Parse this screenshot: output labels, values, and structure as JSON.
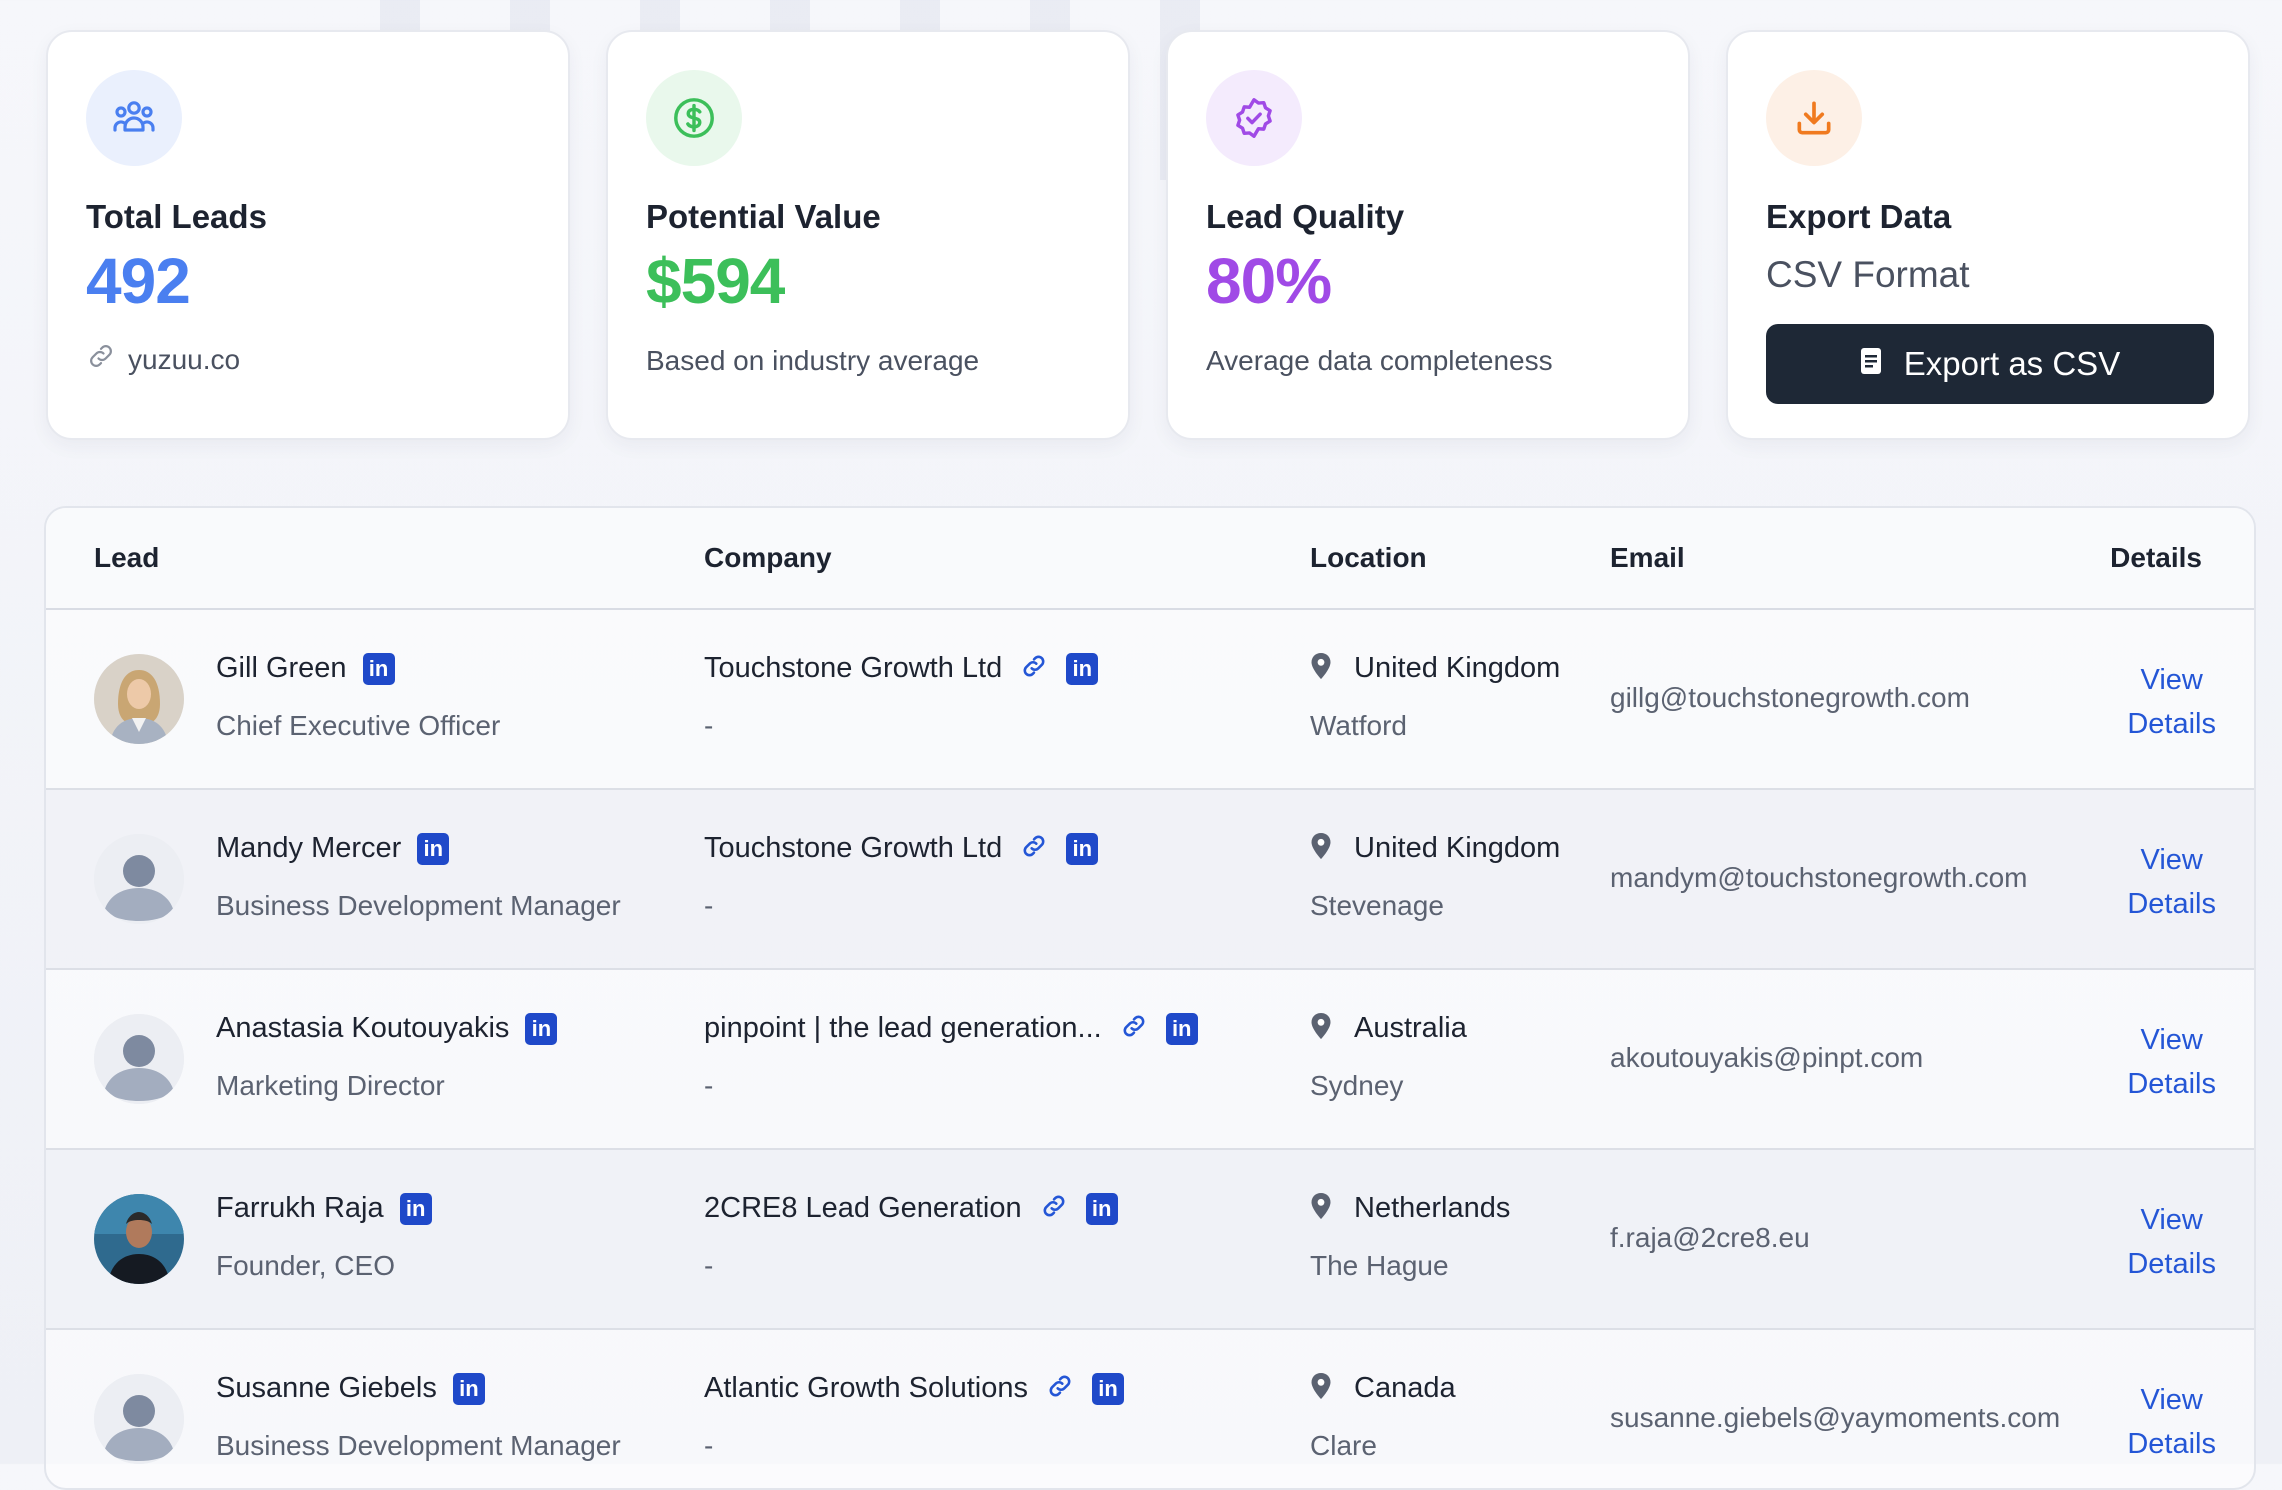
{
  "colors": {
    "blue": "#4a7ff0",
    "green": "#3cbf5a",
    "purple": "#a04ae6",
    "orange": "#f07a1f",
    "dark_button": "#1e2836",
    "link": "#2456d6",
    "linkedin": "#1f49c9"
  },
  "stats": {
    "total_leads": {
      "title": "Total Leads",
      "value": "492",
      "sub": "yuzuu.co",
      "icon": "users-group-icon"
    },
    "potential_value": {
      "title": "Potential Value",
      "value": "$594",
      "sub": "Based on industry average",
      "icon": "dollar-circle-icon"
    },
    "lead_quality": {
      "title": "Lead Quality",
      "value": "80%",
      "sub": "Average data completeness",
      "icon": "verified-badge-icon"
    },
    "export": {
      "title": "Export Data",
      "format": "CSV Format",
      "button": "Export as CSV",
      "icon": "download-icon"
    }
  },
  "table": {
    "headers": {
      "lead": "Lead",
      "company": "Company",
      "location": "Location",
      "email": "Email",
      "details": "Details"
    },
    "rows": [
      {
        "name": "Gill Green",
        "title": "Chief Executive Officer",
        "company": "Touchstone Growth Ltd",
        "company_sub": "-",
        "country": "United Kingdom",
        "city": "Watford",
        "email": "gillg@touchstonegrowth.com",
        "view": "View",
        "details": "Details",
        "avatar": "photo-woman"
      },
      {
        "name": "Mandy Mercer",
        "title": "Business Development Manager",
        "company": "Touchstone Growth Ltd",
        "company_sub": "-",
        "country": "United Kingdom",
        "city": "Stevenage",
        "email": "mandym@touchstonegrowth.com",
        "view": "View",
        "details": "Details",
        "avatar": "placeholder"
      },
      {
        "name": "Anastasia Koutouyakis",
        "title": "Marketing Director",
        "company": "pinpoint | the lead generation...",
        "company_sub": "-",
        "country": "Australia",
        "city": "Sydney",
        "email": "akoutouyakis@pinpt.com",
        "view": "View",
        "details": "Details",
        "avatar": "placeholder"
      },
      {
        "name": "Farrukh Raja",
        "title": "Founder, CEO",
        "company": "2CRE8 Lead Generation",
        "company_sub": "-",
        "country": "Netherlands",
        "city": "The Hague",
        "email": "f.raja@2cre8.eu",
        "view": "View",
        "details": "Details",
        "avatar": "photo-man"
      },
      {
        "name": "Susanne Giebels",
        "title": "Business Development Manager",
        "company": "Atlantic Growth Solutions",
        "company_sub": "-",
        "country": "Canada",
        "city": "Clare",
        "email": "susanne.giebels@yaymoments.com",
        "view": "View",
        "details": "Details",
        "avatar": "placeholder"
      }
    ]
  },
  "linkedin_label": "in"
}
